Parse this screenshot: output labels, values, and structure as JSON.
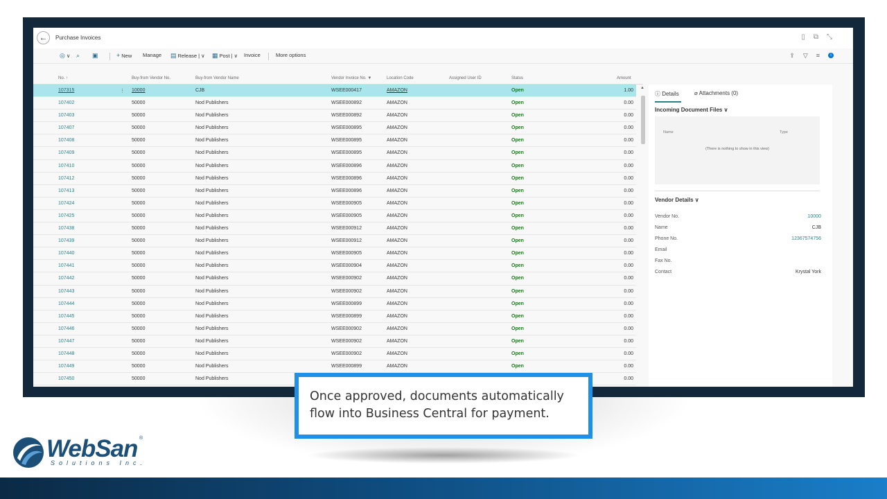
{
  "titlebar": {
    "title": "Purchase Invoices"
  },
  "actions": {
    "new": "New",
    "manage": "Manage",
    "release": "Release",
    "post": "Post",
    "invoice": "Invoice",
    "more": "More options"
  },
  "columns": {
    "no": "No. ↑",
    "vendor_no": "Buy-from Vendor No.",
    "vendor_name": "Buy-from Vendor Name",
    "vendor_invoice": "Vendor Invoice No. ▼",
    "location": "Location Code",
    "assigned": "Assigned User ID",
    "status": "Status",
    "amount": "Amount"
  },
  "rows": [
    {
      "no": "107315",
      "vendor_no": "10000",
      "name": "CJB",
      "inv": "WSEE000417",
      "loc": "AMAZON",
      "status": "Open",
      "amount": "1.00"
    },
    {
      "no": "107402",
      "vendor_no": "50000",
      "name": "Nod Publishers",
      "inv": "WSEE000892",
      "loc": "AMAZON",
      "status": "Open",
      "amount": "0.00"
    },
    {
      "no": "107403",
      "vendor_no": "50000",
      "name": "Nod Publishers",
      "inv": "WSEE000892",
      "loc": "AMAZON",
      "status": "Open",
      "amount": "0.00"
    },
    {
      "no": "107407",
      "vendor_no": "50000",
      "name": "Nod Publishers",
      "inv": "WSEE000895",
      "loc": "AMAZON",
      "status": "Open",
      "amount": "0.00"
    },
    {
      "no": "107408",
      "vendor_no": "50000",
      "name": "Nod Publishers",
      "inv": "WSEE000895",
      "loc": "AMAZON",
      "status": "Open",
      "amount": "0.00"
    },
    {
      "no": "107409",
      "vendor_no": "50000",
      "name": "Nod Publishers",
      "inv": "WSEE000895",
      "loc": "AMAZON",
      "status": "Open",
      "amount": "0.00"
    },
    {
      "no": "107410",
      "vendor_no": "50000",
      "name": "Nod Publishers",
      "inv": "WSEE000896",
      "loc": "AMAZON",
      "status": "Open",
      "amount": "0.00"
    },
    {
      "no": "107412",
      "vendor_no": "50000",
      "name": "Nod Publishers",
      "inv": "WSEE000896",
      "loc": "AMAZON",
      "status": "Open",
      "amount": "0.00"
    },
    {
      "no": "107413",
      "vendor_no": "50000",
      "name": "Nod Publishers",
      "inv": "WSEE000896",
      "loc": "AMAZON",
      "status": "Open",
      "amount": "0.00"
    },
    {
      "no": "107424",
      "vendor_no": "50000",
      "name": "Nod Publishers",
      "inv": "WSEE000905",
      "loc": "AMAZON",
      "status": "Open",
      "amount": "0.00"
    },
    {
      "no": "107425",
      "vendor_no": "50000",
      "name": "Nod Publishers",
      "inv": "WSEE000905",
      "loc": "AMAZON",
      "status": "Open",
      "amount": "0.00"
    },
    {
      "no": "107438",
      "vendor_no": "50000",
      "name": "Nod Publishers",
      "inv": "WSEE000912",
      "loc": "AMAZON",
      "status": "Open",
      "amount": "0.00"
    },
    {
      "no": "107439",
      "vendor_no": "50000",
      "name": "Nod Publishers",
      "inv": "WSEE000912",
      "loc": "AMAZON",
      "status": "Open",
      "amount": "0.00"
    },
    {
      "no": "107440",
      "vendor_no": "50000",
      "name": "Nod Publishers",
      "inv": "WSEE000905",
      "loc": "AMAZON",
      "status": "Open",
      "amount": "0.00"
    },
    {
      "no": "107441",
      "vendor_no": "50000",
      "name": "Nod Publishers",
      "inv": "WSEE000904",
      "loc": "AMAZON",
      "status": "Open",
      "amount": "0.00"
    },
    {
      "no": "107442",
      "vendor_no": "50000",
      "name": "Nod Publishers",
      "inv": "WSEE000902",
      "loc": "AMAZON",
      "status": "Open",
      "amount": "0.00"
    },
    {
      "no": "107443",
      "vendor_no": "50000",
      "name": "Nod Publishers",
      "inv": "WSEE000902",
      "loc": "AMAZON",
      "status": "Open",
      "amount": "0.00"
    },
    {
      "no": "107444",
      "vendor_no": "50000",
      "name": "Nod Publishers",
      "inv": "WSEE000899",
      "loc": "AMAZON",
      "status": "Open",
      "amount": "0.00"
    },
    {
      "no": "107445",
      "vendor_no": "50000",
      "name": "Nod Publishers",
      "inv": "WSEE000899",
      "loc": "AMAZON",
      "status": "Open",
      "amount": "0.00"
    },
    {
      "no": "107446",
      "vendor_no": "50000",
      "name": "Nod Publishers",
      "inv": "WSEE000902",
      "loc": "AMAZON",
      "status": "Open",
      "amount": "0.00"
    },
    {
      "no": "107447",
      "vendor_no": "50000",
      "name": "Nod Publishers",
      "inv": "WSEE000902",
      "loc": "AMAZON",
      "status": "Open",
      "amount": "0.00"
    },
    {
      "no": "107448",
      "vendor_no": "50000",
      "name": "Nod Publishers",
      "inv": "WSEE000902",
      "loc": "AMAZON",
      "status": "Open",
      "amount": "0.00"
    },
    {
      "no": "107449",
      "vendor_no": "50000",
      "name": "Nod Publishers",
      "inv": "WSEE000899",
      "loc": "AMAZON",
      "status": "Open",
      "amount": "0.00"
    },
    {
      "no": "107450",
      "vendor_no": "50000",
      "name": "Nod Publishers",
      "inv": "",
      "loc": "",
      "status": "",
      "amount": "0.00"
    }
  ],
  "factbox": {
    "tab_details": "Details",
    "tab_attachments": "Attachments (0)",
    "incoming_title": "Incoming Document Files",
    "col_name": "Name",
    "col_type": "Type",
    "empty_msg": "(There is nothing to show in this view)",
    "vendor_title": "Vendor Details",
    "vendor_no_label": "Vendor No.",
    "vendor_no_value": "10000",
    "name_label": "Name",
    "name_value": "CJB",
    "phone_label": "Phone No.",
    "phone_value": "12367574756",
    "email_label": "Email",
    "fax_label": "Fax No.",
    "contact_label": "Contact",
    "contact_value": "Krystal York"
  },
  "callout": {
    "text": "Once approved, documents automatically flow into Business Central for payment."
  },
  "logo": {
    "word": "WebSan",
    "sub": "Solutions Inc."
  },
  "colors": {
    "accent": "#2a8087",
    "selected_row": "#a8e6ec",
    "status_open": "#107c10",
    "callout_border": "#1e90e8",
    "frame": "#14283b"
  }
}
